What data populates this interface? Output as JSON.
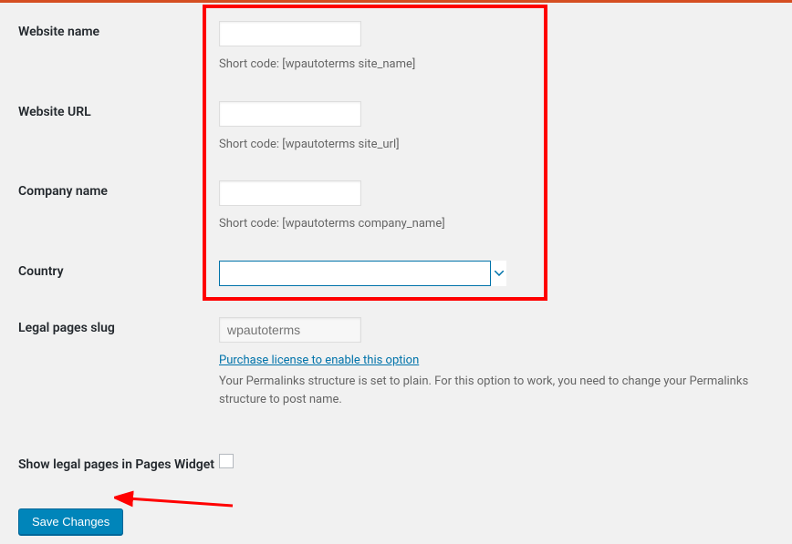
{
  "fields": {
    "website_name": {
      "label": "Website name",
      "short_code": "Short code: [wpautoterms site_name]"
    },
    "website_url": {
      "label": "Website URL",
      "short_code": "Short code: [wpautoterms site_url]"
    },
    "company_name": {
      "label": "Company name",
      "short_code": "Short code: [wpautoterms company_name]"
    },
    "country": {
      "label": "Country"
    },
    "legal_slug": {
      "label": "Legal pages slug",
      "placeholder": "wpautoterms",
      "license_link": "Purchase license to enable this option",
      "help": "Your Permalinks structure is set to plain. For this option to work, you need to change your Permalinks structure to post name."
    },
    "show_widget": {
      "label": "Show legal pages in Pages Widget"
    }
  },
  "buttons": {
    "save": "Save Changes"
  }
}
